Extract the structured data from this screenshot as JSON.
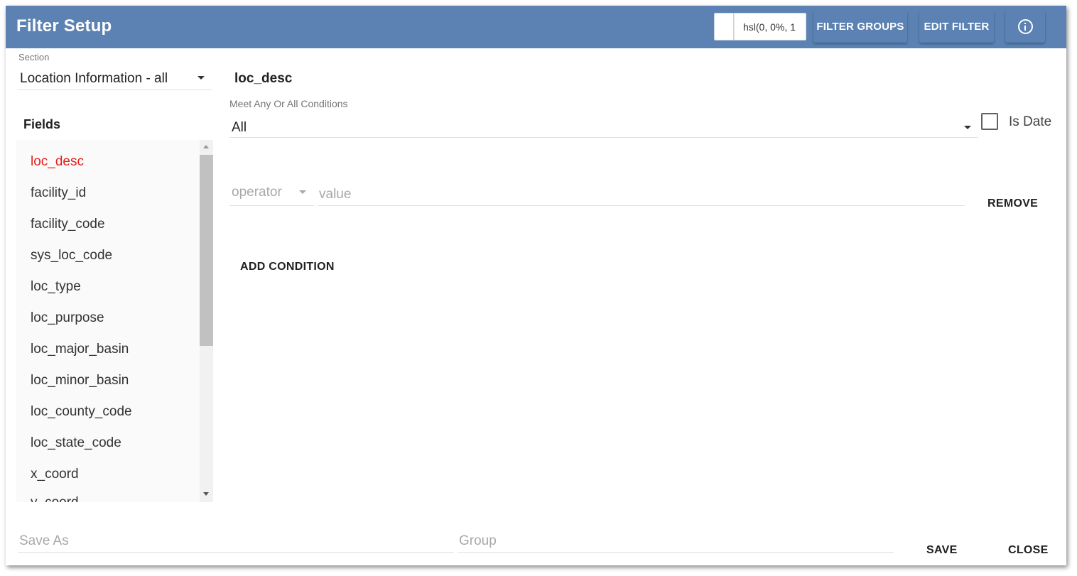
{
  "header": {
    "title": "Filter Setup",
    "color_value": "hsl(0, 0%, 1",
    "filter_groups_label": "FILTER GROUPS",
    "edit_filter_label": "EDIT FILTER",
    "info_icon": "info-icon",
    "background_color": "#5b82b3"
  },
  "section": {
    "label": "Section",
    "selected": "Location Information - all"
  },
  "fields": {
    "title": "Fields",
    "active_color": "#e81e1e",
    "items": [
      "loc_desc",
      "facility_id",
      "facility_code",
      "sys_loc_code",
      "loc_type",
      "loc_purpose",
      "loc_major_basin",
      "loc_minor_basin",
      "loc_county_code",
      "loc_state_code",
      "x_coord",
      "y_coord"
    ],
    "selected_index": 0
  },
  "editor": {
    "field_name": "loc_desc",
    "meet_label": "Meet Any Or All Conditions",
    "meet_value": "All",
    "is_date_label": "Is Date",
    "is_date_checked": false,
    "condition": {
      "operator_placeholder": "operator",
      "value_placeholder": "value",
      "remove_label": "REMOVE"
    },
    "add_condition_label": "ADD CONDITION"
  },
  "footer": {
    "save_as_placeholder": "Save As",
    "group_placeholder": "Group",
    "save_label": "SAVE",
    "close_label": "CLOSE"
  }
}
